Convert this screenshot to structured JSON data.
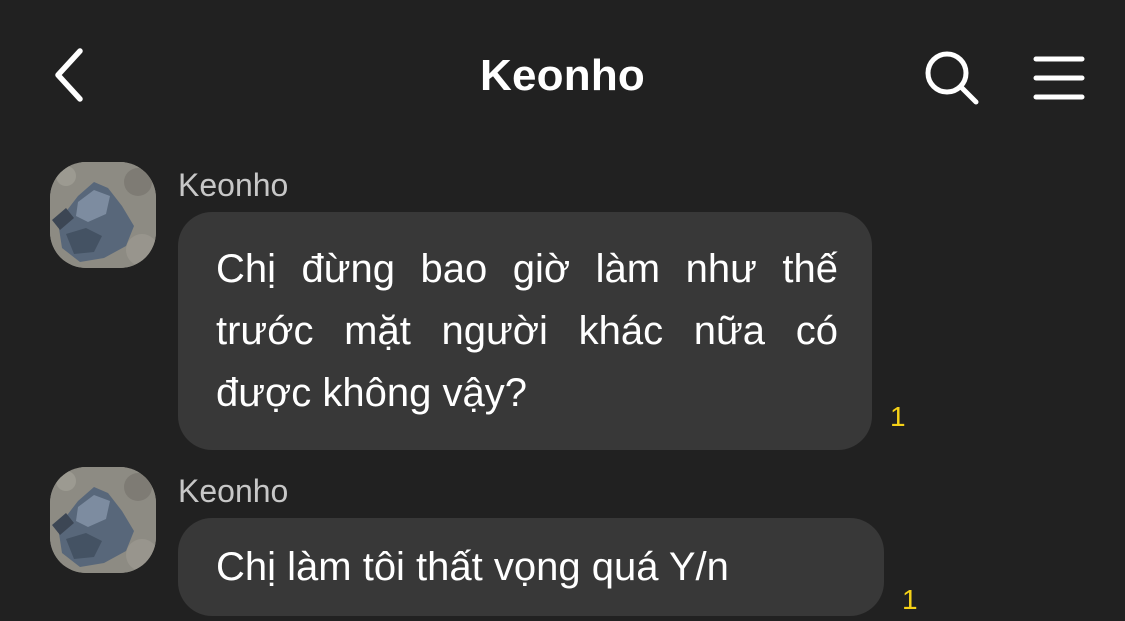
{
  "header": {
    "title": "Keonho",
    "back_icon": "chevron-left-icon",
    "search_icon": "search-icon",
    "menu_icon": "hamburger-menu-icon"
  },
  "messages": [
    {
      "sender": "Keonho",
      "text": "Chị đừng bao giờ làm như thế trước mặt người khác nữa có được không vậy?",
      "unread_count": "1"
    },
    {
      "sender": "Keonho",
      "text": "Chị làm tôi thất vọng quá Y/n",
      "unread_count": "1"
    }
  ],
  "colors": {
    "background": "#212121",
    "bubble": "#383838",
    "unread_count": "#f5d117",
    "sender_name": "#c7c7c7"
  }
}
